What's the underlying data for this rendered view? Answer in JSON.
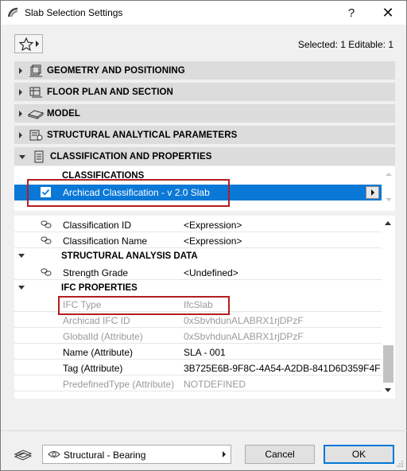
{
  "window": {
    "title": "Slab Selection Settings",
    "help_label": "?",
    "close_label": "✕"
  },
  "header": {
    "selected_info": "Selected: 1 Editable: 1"
  },
  "panels": [
    {
      "label": "GEOMETRY AND POSITIONING",
      "icon": "geometry-icon",
      "expanded": false
    },
    {
      "label": "FLOOR PLAN AND SECTION",
      "icon": "floor-plan-icon",
      "expanded": false
    },
    {
      "label": "MODEL",
      "icon": "model-icon",
      "expanded": false
    },
    {
      "label": "STRUCTURAL ANALYTICAL PARAMETERS",
      "icon": "structural-analytical-icon",
      "expanded": false
    },
    {
      "label": "CLASSIFICATION AND PROPERTIES",
      "icon": "classification-icon",
      "expanded": true
    }
  ],
  "classifications": {
    "title": "CLASSIFICATIONS",
    "selected_item": "Archicad Classification - v 2.0 Slab",
    "checked": true
  },
  "properties": {
    "rows": [
      {
        "name": "Classification ID",
        "value": "<Expression>",
        "type": "linked"
      },
      {
        "name": "Classification Name",
        "value": "<Expression>",
        "type": "linked"
      },
      {
        "name": "STRUCTURAL ANALYSIS DATA",
        "value": "",
        "type": "section"
      },
      {
        "name": "Strength Grade",
        "value": "<Undefined>",
        "type": "linked"
      },
      {
        "name": "IFC PROPERTIES",
        "value": "",
        "type": "section"
      },
      {
        "name": "IFC Type",
        "value": "IfcSlab",
        "type": "grey"
      },
      {
        "name": "Archicad IFC ID",
        "value": "0xSbvhdunALABRX1rjDPzF",
        "type": "grey"
      },
      {
        "name": "GlobalId (Attribute)",
        "value": "0xSbvhdunALABRX1rjDPzF",
        "type": "grey"
      },
      {
        "name": "Name (Attribute)",
        "value": "SLA - 001",
        "type": "plain"
      },
      {
        "name": "Tag (Attribute)",
        "value": "3B725E6B-9F8C-4A54-A2DB-841D6D359F4F",
        "type": "plain"
      },
      {
        "name": "PredefinedType (Attribute)",
        "value": "NOTDEFINED",
        "type": "grey"
      }
    ]
  },
  "footer": {
    "layer_combo": "Structural - Bearing",
    "cancel_label": "Cancel",
    "ok_label": "OK"
  },
  "colors": {
    "selection_blue": "#0a78d7",
    "highlight_red": "#b21e1e",
    "panel_header": "#dcdcdc"
  }
}
